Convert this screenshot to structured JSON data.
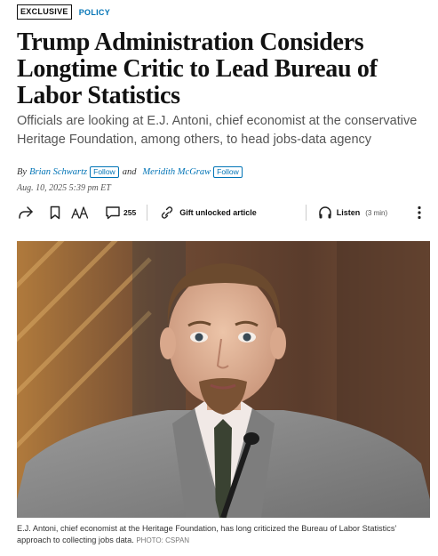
{
  "tags": {
    "exclusive": "EXCLUSIVE",
    "section": "POLICY"
  },
  "headline": "Trump Administration Considers Longtime Critic to Lead Bureau of Labor Statistics",
  "dek": "Officials are looking at E.J. Antoni, chief economist at the conservative Heritage Foundation, among others, to head jobs-data agency",
  "byline": {
    "prefix": "By",
    "authors": [
      {
        "name": "Brian Schwartz",
        "follow": "Follow"
      },
      {
        "name": "Meridith McGraw",
        "follow": "Follow"
      }
    ],
    "conjunction": "and",
    "date": "Aug. 10, 2025 5:39 pm ET"
  },
  "toolbar": {
    "icons": [
      "share-icon",
      "bookmark-icon",
      "text-size-icon",
      "comment-icon",
      "gift-icon",
      "headphones-icon",
      "more-icon"
    ],
    "comment_count": "255",
    "gift_label": "Gift unlocked article",
    "listen_label": "Listen",
    "listen_duration": "(3 min)"
  },
  "photo": {
    "colors": {
      "background_wood": "#6e4a32",
      "suit": "#8c8c8c",
      "skin": "#e0b69a",
      "hair": "#6b4a2e",
      "shirt": "#f1e9e6",
      "tie": "#3a4232"
    }
  },
  "caption": {
    "text": "E.J. Antoni, chief economist at the Heritage Foundation, has long criticized the Bureau of Labor Statistics’ approach to collecting jobs data.",
    "credit": "PHOTO: CSPAN"
  },
  "colors": {
    "link": "#0274b6",
    "dek": "#555555",
    "text": "#111111"
  }
}
